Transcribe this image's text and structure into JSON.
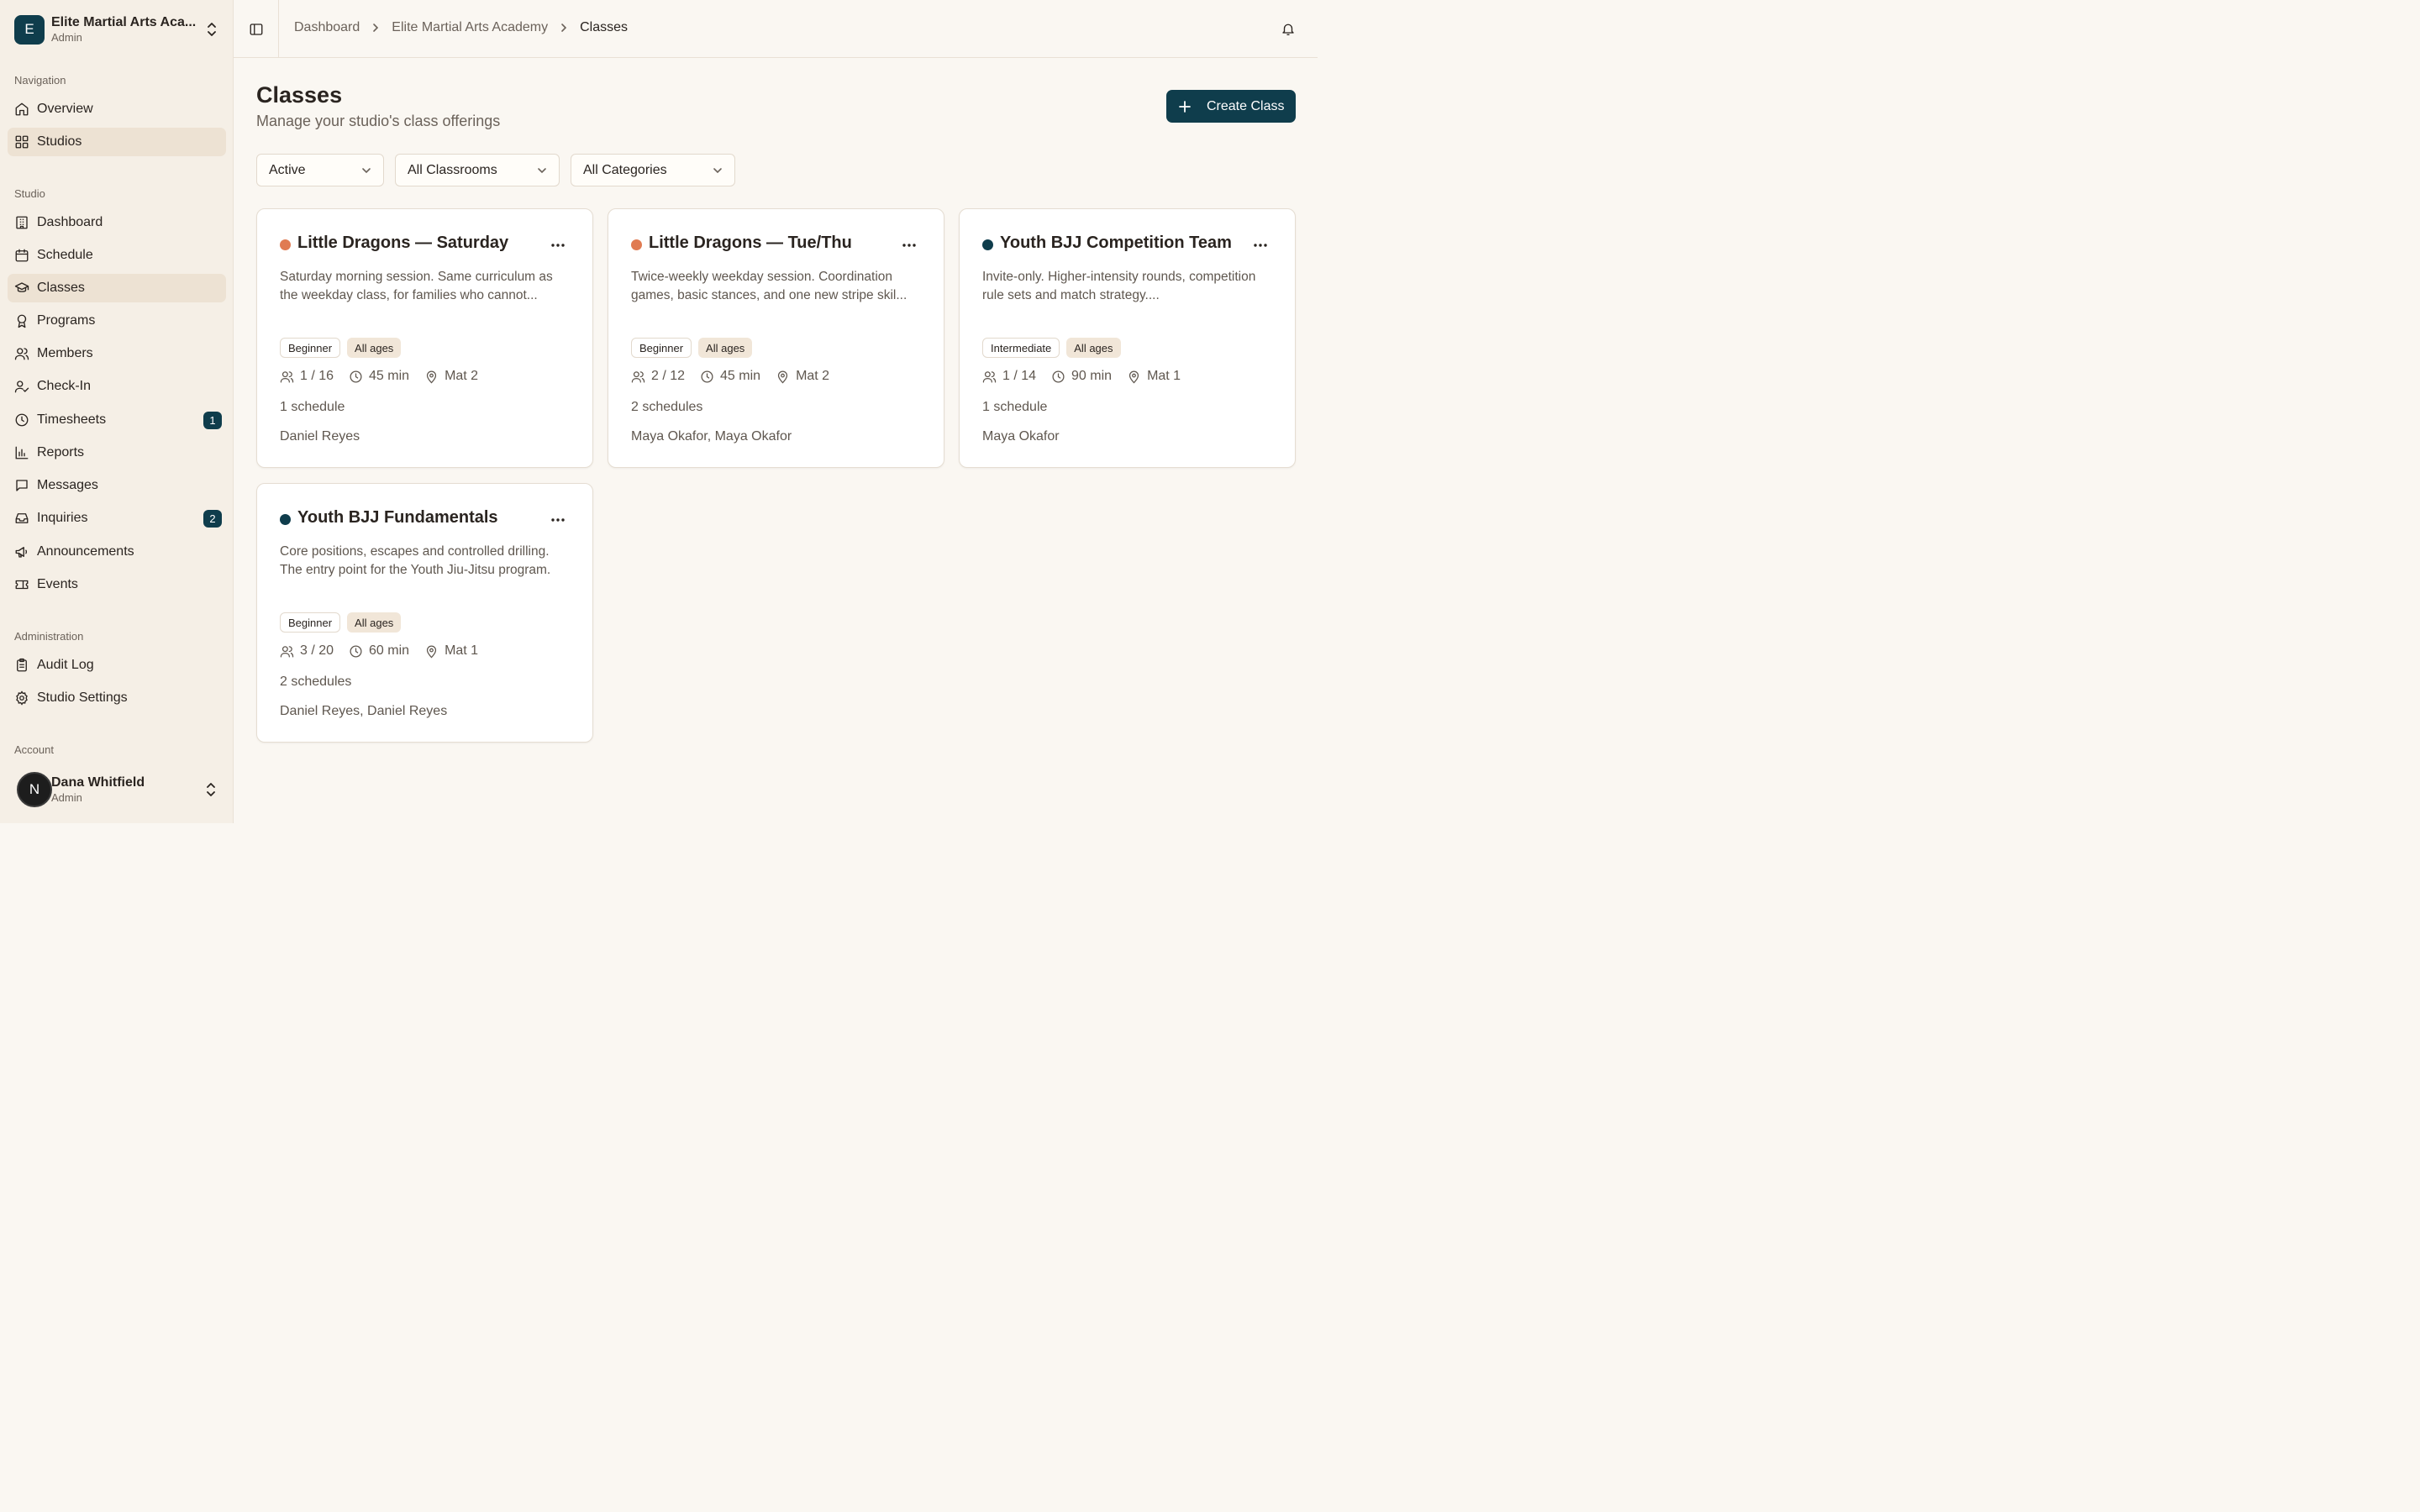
{
  "org": {
    "initial": "E",
    "name": "Elite Martial Arts Aca...",
    "role": "Admin"
  },
  "sidebar": {
    "sections": {
      "navigation": "Navigation",
      "studio": "Studio",
      "administration": "Administration",
      "account": "Account"
    },
    "navigation": [
      {
        "label": "Overview",
        "icon": "home-icon"
      },
      {
        "label": "Studios",
        "icon": "grid-icon",
        "active": true
      }
    ],
    "studio": [
      {
        "label": "Dashboard",
        "icon": "building-icon"
      },
      {
        "label": "Schedule",
        "icon": "calendar-icon"
      },
      {
        "label": "Classes",
        "icon": "graduation-cap-icon",
        "active": true
      },
      {
        "label": "Programs",
        "icon": "award-icon"
      },
      {
        "label": "Members",
        "icon": "users-icon"
      },
      {
        "label": "Check-In",
        "icon": "user-check-icon"
      },
      {
        "label": "Timesheets",
        "icon": "clock-icon",
        "badge": "1"
      },
      {
        "label": "Reports",
        "icon": "bar-chart-icon"
      },
      {
        "label": "Messages",
        "icon": "message-icon"
      },
      {
        "label": "Inquiries",
        "icon": "inbox-icon",
        "badge": "2"
      },
      {
        "label": "Announcements",
        "icon": "megaphone-icon"
      },
      {
        "label": "Events",
        "icon": "ticket-icon"
      }
    ],
    "administration": [
      {
        "label": "Audit Log",
        "icon": "clipboard-icon"
      },
      {
        "label": "Studio Settings",
        "icon": "gear-icon"
      }
    ]
  },
  "account": {
    "initial": "N",
    "name": "Dana Whitfield",
    "role": "Admin"
  },
  "breadcrumbs": [
    "Dashboard",
    "Elite Martial Arts Academy",
    "Classes"
  ],
  "page": {
    "title": "Classes",
    "subtitle": "Manage your studio's class offerings",
    "create_label": "Create Class"
  },
  "filters": {
    "status": "Active",
    "classroom": "All Classrooms",
    "category": "All Categories"
  },
  "colors": {
    "accent": "#0f3d4c",
    "orange_dot": "#e07b52",
    "teal_dot": "#0f3d4c"
  },
  "cards": [
    {
      "title": "Little Dragons — Saturday",
      "dot": "#e07b52",
      "description": "Saturday morning session. Same curriculum as the weekday class, for families who cannot...",
      "level": "Beginner",
      "ages": "All ages",
      "capacity": "1 / 16",
      "duration": "45 min",
      "location": "Mat 2",
      "schedules": "1 schedule",
      "instructors": "Daniel Reyes"
    },
    {
      "title": "Little Dragons — Tue/Thu",
      "dot": "#e07b52",
      "description": "Twice-weekly weekday session. Coordination games, basic stances, and one new stripe skil...",
      "level": "Beginner",
      "ages": "All ages",
      "capacity": "2 / 12",
      "duration": "45 min",
      "location": "Mat 2",
      "schedules": "2 schedules",
      "instructors": "Maya Okafor, Maya Okafor"
    },
    {
      "title": "Youth BJJ Competition Team",
      "dot": "#0f3d4c",
      "description": "Invite-only. Higher-intensity rounds, competition rule sets and match strategy....",
      "level": "Intermediate",
      "ages": "All ages",
      "capacity": "1 / 14",
      "duration": "90 min",
      "location": "Mat 1",
      "schedules": "1 schedule",
      "instructors": "Maya Okafor"
    },
    {
      "title": "Youth BJJ Fundamentals",
      "dot": "#0f3d4c",
      "description": "Core positions, escapes and controlled drilling. The entry point for the Youth Jiu-Jitsu program.",
      "level": "Beginner",
      "ages": "All ages",
      "capacity": "3 / 20",
      "duration": "60 min",
      "location": "Mat 1",
      "schedules": "2 schedules",
      "instructors": "Daniel Reyes, Daniel Reyes"
    }
  ]
}
